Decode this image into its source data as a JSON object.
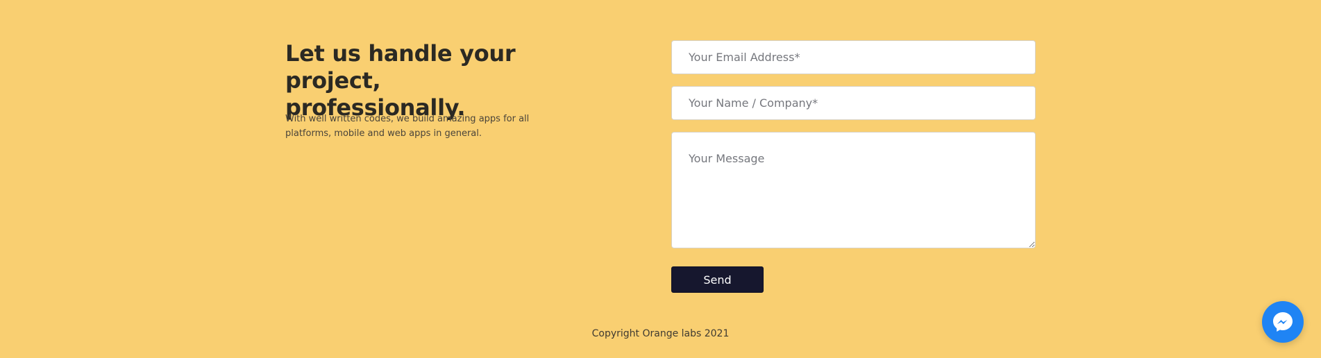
{
  "hero": {
    "heading_line_1": "Let us handle your",
    "heading_line_2": "project, professionally.",
    "subtext": "With well written codes, we build amazing apps for all platforms, mobile and web apps in general."
  },
  "contact_form": {
    "email_placeholder": "Your Email Address*",
    "name_placeholder": "Your Name / Company*",
    "message_placeholder": "Your Message",
    "send_label": "Send"
  },
  "footer": {
    "copyright": "Copyright Orange labs 2021"
  },
  "chat_widget": {
    "icon": "messenger-icon"
  },
  "colors": {
    "background": "#f9cf71",
    "button": "#16172e",
    "messenger": "#1f84f4"
  }
}
